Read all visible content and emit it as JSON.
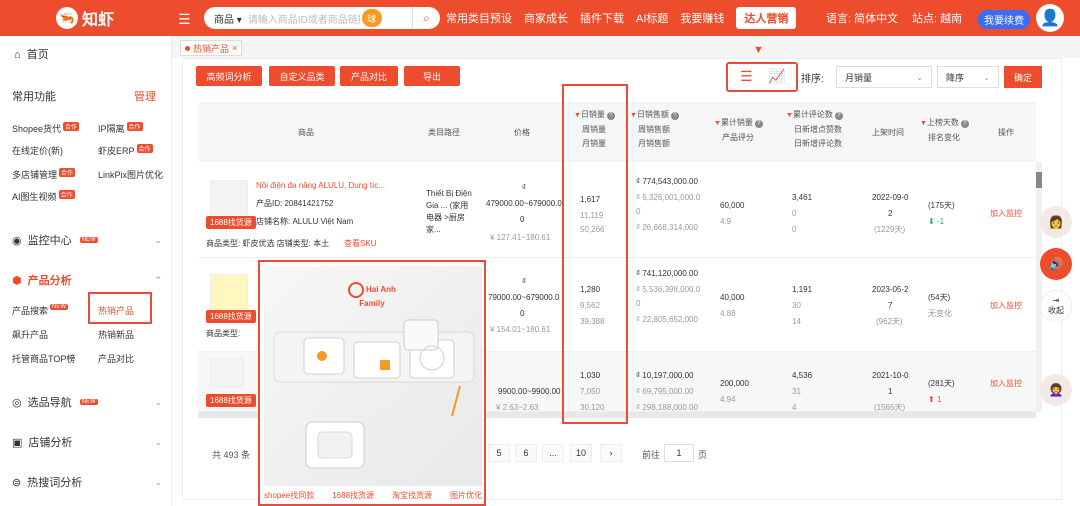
{
  "topbar": {
    "logo": "知虾",
    "search_select": "商品",
    "search_placeholder": "请输入商品ID或者商品链接",
    "search_accent": "球",
    "nav": [
      "常用类目预设",
      "商家成长",
      "插件下载",
      "AI标题",
      "我要赚钱"
    ],
    "nav_pill": "达人营销",
    "language": "语言: 简体中文",
    "site": "站点: 越南",
    "renew": "我要续费"
  },
  "sidebar": {
    "home": "首页",
    "common": "常用功能",
    "manage": "管理",
    "links": [
      {
        "label": "Shopee货代",
        "badge": "合作"
      },
      {
        "label": "IP隔离",
        "badge": "合作"
      },
      {
        "label": "在线定价(新)",
        "badge": ""
      },
      {
        "label": "虾皮ERP",
        "badge": "合作"
      },
      {
        "label": "多店铺管理",
        "badge": "合作"
      },
      {
        "label": "LinkPix图片优化",
        "badge": ""
      },
      {
        "label": "AI图生视频",
        "badge": "合作"
      }
    ],
    "monitor": "监控中心",
    "new_badge": "NEW",
    "analysis": "产品分析",
    "analysis_links": [
      "产品搜索",
      "热销产品",
      "飙升产品",
      "热销新品",
      "托管商品TOP榜",
      "产品对比"
    ],
    "selection": "选品导航",
    "shop": "店铺分析",
    "keywords": "热搜词分析"
  },
  "tab": {
    "label": "热销产品",
    "close": "×"
  },
  "toolbar": {
    "buttons": [
      "高频词分析",
      "自定义品类",
      "产品对比",
      "导出"
    ],
    "sort_label": "排序:",
    "sort_value": "月销量",
    "order_value": "降序",
    "confirm": "确定"
  },
  "headers": {
    "product": "商品",
    "category": "类目路径",
    "price": "价格",
    "daily_sales": "日销量",
    "weekly_sales": "周销量",
    "monthly_sales": "月销量",
    "daily_revenue": "日销售额",
    "weekly_revenue": "周销售额",
    "monthly_revenue": "月销售额",
    "total_sales": "累计销量",
    "rating": "产品评分",
    "total_reviews": "累计评论数",
    "new_likes": "日新增点赞数",
    "new_reviews": "日新增评论数",
    "listed_time": "上架时间",
    "days_listed": "上榜天数",
    "rank_change": "排名变化",
    "action": "操作"
  },
  "rows": [
    {
      "name": "Nồi điện đa năng ALULU, Dung tíc...",
      "id": "产品ID: 20841421752",
      "shop": "店铺名称: ALULU Việt Nam",
      "type": "商品类型: 虾皮优选  店铺类型: 本土",
      "sku": "查看SKU",
      "tag": "1688找货源",
      "category": "Thiết Bị Điện Gia ... (家用电器 >厨房家...",
      "price1": "₫",
      "price2": "479000.00~679000.0",
      "price3": "0",
      "price4": "¥ 127.41~180.61",
      "daily": "1,617",
      "weekly": "11,119",
      "monthly": "50,266",
      "rev_d": "₫ 774,543,000.00",
      "rev_w": "₫ 5,326,001,000.0",
      "rev_w2": "0",
      "rev_m": "₫ 26,668,314,000",
      "total": "60,000",
      "rating": "4.9",
      "reviews": "3,461",
      "likes": "0",
      "new_rev": "0",
      "date1": "2022-09-0",
      "date2": "2",
      "date3": "(1229天)",
      "days": "(175天)",
      "rank": "⬇ -1",
      "action": "加入监控"
    },
    {
      "name": "",
      "id": "",
      "shop": "",
      "type": "商品类型:",
      "sku": "",
      "tag": "1688找货源",
      "category": "",
      "price1": "₫",
      "price2": "79000.00~679000.0",
      "price3": "0",
      "price4": "¥ 154.01~180.61",
      "daily": "1,280",
      "weekly": "9,562",
      "monthly": "39,388",
      "rev_d": "₫ 741,120,000.00",
      "rev_w": "₫ 5,536,398,000.0",
      "rev_w2": "0",
      "rev_m": "₫ 22,805,652,000",
      "total": "40,000",
      "rating": "4.88",
      "reviews": "1,191",
      "likes": "30",
      "new_rev": "14",
      "date1": "2023-05-2",
      "date2": "7",
      "date3": "(962天)",
      "days": "(54天)",
      "rank": "无变化",
      "action": "加入监控"
    },
    {
      "name": "",
      "id": "",
      "shop": "",
      "type": "",
      "sku": "",
      "tag": "1688找货源",
      "category": "",
      "price1": "",
      "price2": "9900.00~9900.00",
      "price3": "",
      "price4": "¥ 2.63~2.63",
      "daily": "1,030",
      "weekly": "7,050",
      "monthly": "30,120",
      "rev_d": "₫ 10,197,000.00",
      "rev_w": "₫ 69,795,000.00",
      "rev_w2": "",
      "rev_m": "₫ 298,188,000.00",
      "total": "200,000",
      "rating": "4.94",
      "reviews": "4,536",
      "likes": "31",
      "new_rev": "4",
      "date1": "2021-10-0",
      "date2": "1",
      "date3": "(1565天)",
      "days": "(281天)",
      "rank": "⬆ 1",
      "action": "加入监控"
    }
  ],
  "pagination": {
    "total": "共 493 条",
    "pages": [
      "5",
      "6",
      "...",
      "10"
    ],
    "next": "›",
    "goto": "前往",
    "page_value": "1",
    "page_suffix": "页"
  },
  "popup": {
    "brand1": "Hai Anh",
    "brand2": "Family",
    "links": [
      "shopee找同款",
      "1688找货源",
      "淘宝找货源",
      "图片优化"
    ]
  },
  "float": {
    "collapse": "收起"
  }
}
